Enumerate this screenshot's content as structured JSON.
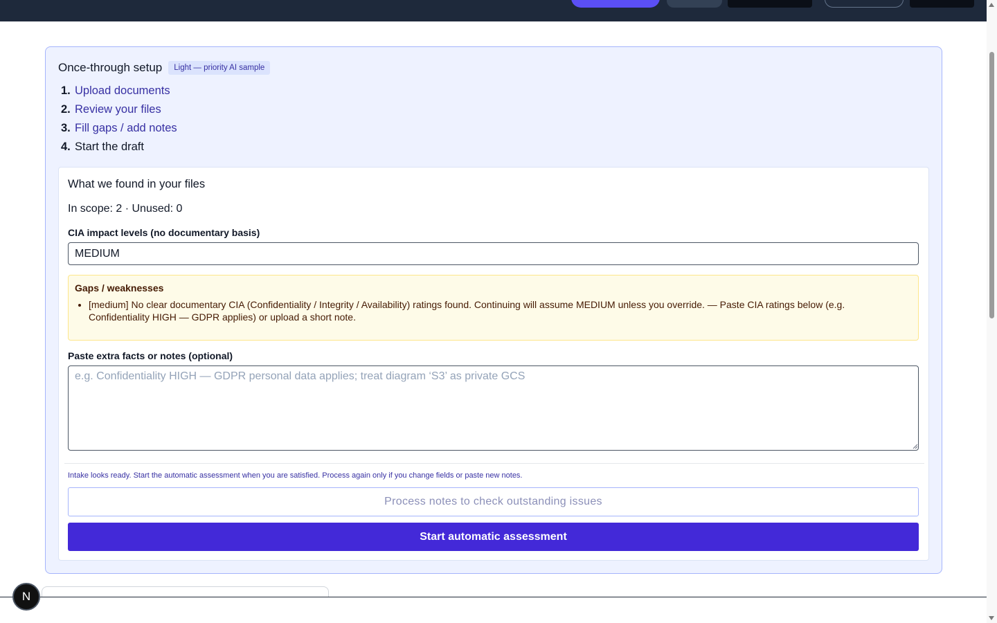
{
  "setup": {
    "title": "Once-through setup",
    "badge": "Light — priority AI sample",
    "steps": [
      {
        "num": "1.",
        "label": "Upload documents"
      },
      {
        "num": "2.",
        "label": "Review your files"
      },
      {
        "num": "3.",
        "label": "Fill gaps / add notes"
      },
      {
        "num": "4.",
        "label": "Start the draft"
      }
    ]
  },
  "found": {
    "title": "What we found in your files",
    "scope": "In scope: 2 · Unused: 0",
    "cia_label": "CIA impact levels (no documentary basis)",
    "cia_value": "MEDIUM",
    "gaps_title": "Gaps / weaknesses",
    "gaps": [
      "[medium] No clear documentary CIA (Confidentiality / Integrity / Availability) ratings found. Continuing will assume MEDIUM unless you override. — Paste CIA ratings below (e.g. Confidentiality HIGH — GDPR applies) or upload a short note."
    ],
    "notes_label": "Paste extra facts or notes (optional)",
    "notes_placeholder": "e.g. Confidentiality HIGH — GDPR personal data applies; treat diagram ‘S3’ as private GCS",
    "notes_value": "",
    "hint": "Intake looks ready. Start the automatic assessment when you are satisfied. Process again only if you change fields or paste new notes.",
    "process_label": "Process notes to check outstanding issues",
    "start_label": "Start automatic assessment"
  },
  "fab": {
    "letter": "N"
  },
  "colors": {
    "accent": "#4329d8",
    "card_bg": "#eef2ff",
    "gaps_bg": "#fefbe8",
    "topbar": "#1e293b"
  }
}
